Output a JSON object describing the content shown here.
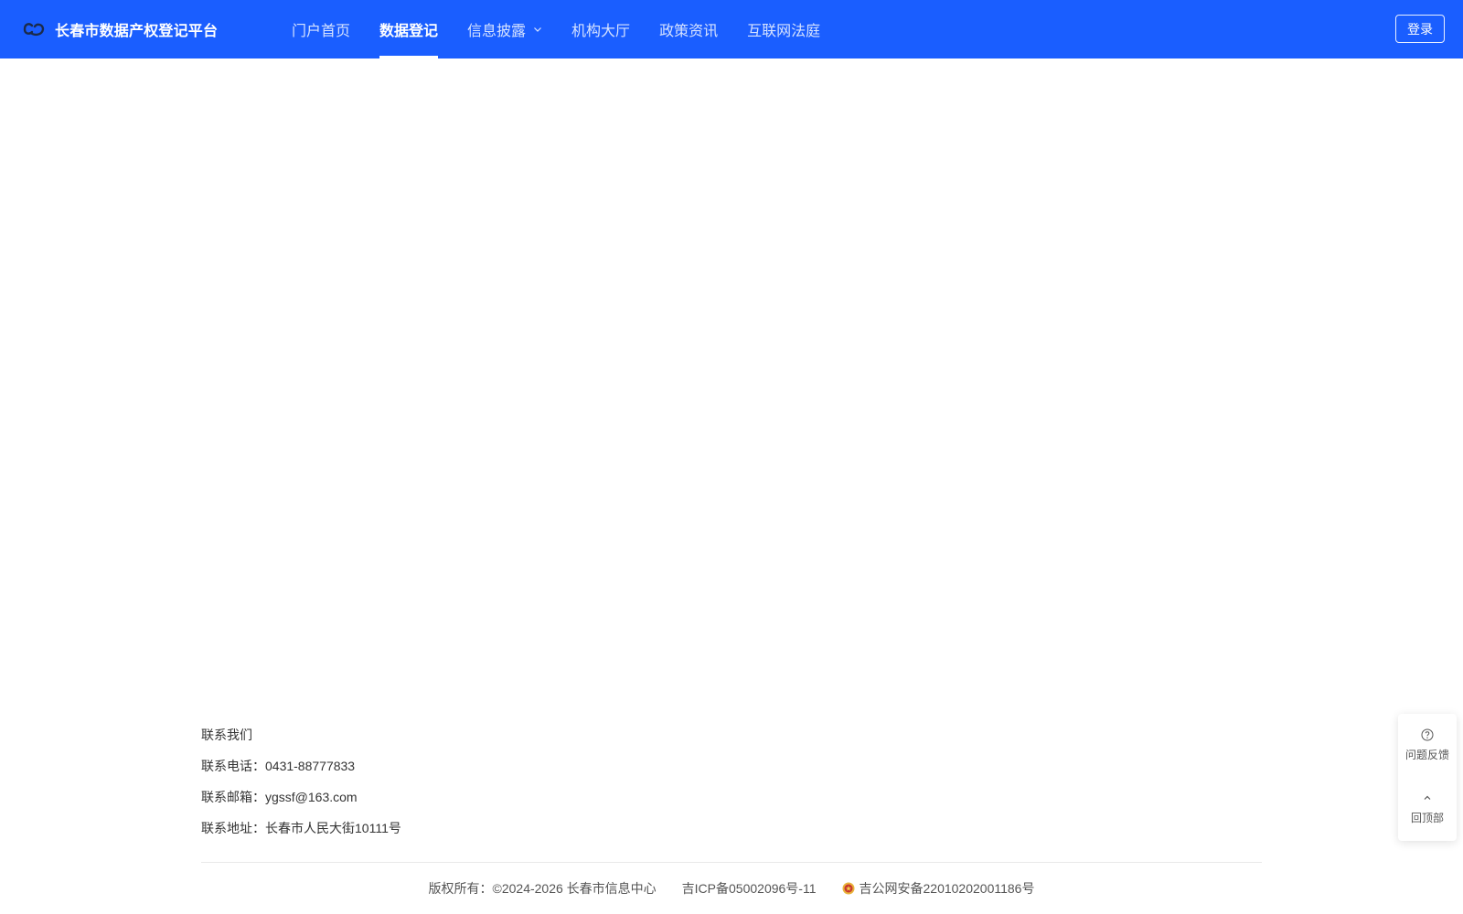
{
  "header": {
    "brand_title": "长春市数据产权登记平台",
    "nav": [
      {
        "label": "门户首页"
      },
      {
        "label": "数据登记"
      },
      {
        "label": "信息披露"
      },
      {
        "label": "机构大厅"
      },
      {
        "label": "政策资讯"
      },
      {
        "label": "互联网法庭"
      }
    ],
    "active_nav": "数据登记",
    "login_label": "登录",
    "accent_color": "#1a5eff"
  },
  "footer": {
    "contact_title": "联系我们",
    "phone": "联系电话：0431-88777833",
    "email": "联系邮箱：ygssf@163.com",
    "address": "联系地址：长春市人民大街10111号",
    "copyright": "版权所有：©2024-2026 长春市信息中心",
    "icp": "吉ICP备05002096号-11",
    "police_record": "吉公网安备22010202001186号"
  },
  "float_panel": {
    "feedback_label": "问题反馈",
    "back_to_top_label": "回顶部"
  },
  "icons": {
    "logo": "link-logo-icon",
    "dropdown": "chevron-down-icon",
    "feedback": "question-circle-icon",
    "top": "chevron-up-icon",
    "police": "police-badge-icon"
  }
}
